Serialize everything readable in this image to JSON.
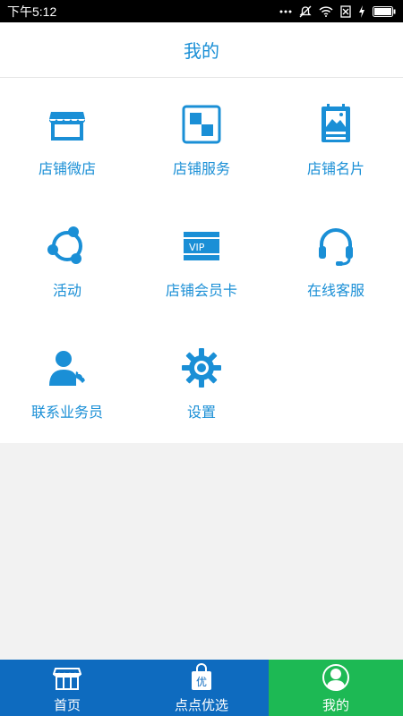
{
  "status_bar": {
    "time": "下午5:12"
  },
  "header": {
    "title": "我的"
  },
  "colors": {
    "accent": "#1a8fd6",
    "nav_blue": "#0e6bbf",
    "nav_green": "#1db954"
  },
  "menu": {
    "items": [
      {
        "label": "店铺微店",
        "icon": "storefront-icon"
      },
      {
        "label": "店铺服务",
        "icon": "squares-icon"
      },
      {
        "label": "店铺名片",
        "icon": "photo-card-icon"
      },
      {
        "label": "活动",
        "icon": "share-circle-icon"
      },
      {
        "label": "店铺会员卡",
        "icon": "vip-card-icon"
      },
      {
        "label": "在线客服",
        "icon": "headset-icon"
      },
      {
        "label": "联系业务员",
        "icon": "person-phone-icon"
      },
      {
        "label": "设置",
        "icon": "gear-icon"
      }
    ]
  },
  "bottom_nav": {
    "tabs": [
      {
        "label": "首页",
        "icon": "store-icon",
        "active": false
      },
      {
        "label": "点点优选",
        "icon": "shopping-bag-icon",
        "badge_text": "优",
        "active": false
      },
      {
        "label": "我的",
        "icon": "user-circle-icon",
        "active": true
      }
    ]
  }
}
